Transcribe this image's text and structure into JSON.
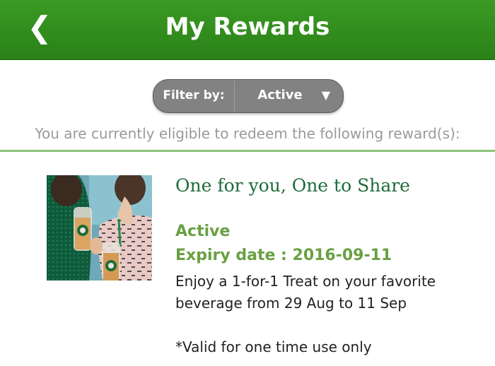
{
  "header": {
    "back_icon": "chevron-left-icon",
    "back_glyph": "❮",
    "title": "My Rewards",
    "color": "#2e8a1b"
  },
  "filter": {
    "label": "Filter by:",
    "value": "Active",
    "arrow_glyph": "▼"
  },
  "eligible_text": "You are currently eligible to redeem the following reward(s):",
  "reward": {
    "title": "One for you, One to Share",
    "status": "Active",
    "expiry": "Expiry date : 2016-09-11",
    "description": "Enjoy a 1-for-1 Treat on your favorite beverage from 29 Aug to 11 Sep",
    "note": "*Valid for one time use only",
    "accent": "#6aa043"
  }
}
